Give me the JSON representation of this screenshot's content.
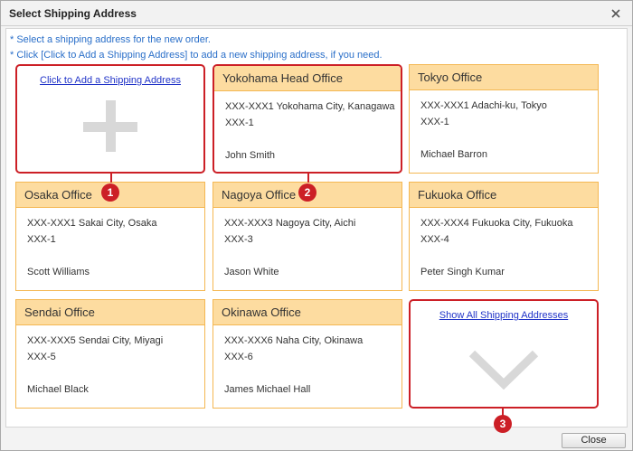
{
  "dialog": {
    "title": "Select Shipping Address",
    "close_icon": "close-icon"
  },
  "instructions": [
    "* Select a shipping address for the new order.",
    "* Click [Click to Add a Shipping Address] to add a new shipping address, if you need."
  ],
  "add_card": {
    "link": "Click to Add a Shipping Address",
    "icon": "plus-icon"
  },
  "offices": [
    {
      "name": "Yokohama Head Office",
      "line1": "XXX-XXX1 Yokohama City, Kanagawa",
      "line2": "XXX-1",
      "person": "John Smith"
    },
    {
      "name": "Tokyo Office",
      "line1": "XXX-XXX1 Adachi-ku, Tokyo",
      "line2": "XXX-1",
      "person": "Michael Barron"
    },
    {
      "name": "Osaka Office",
      "line1": "XXX-XXX1 Sakai City, Osaka",
      "line2": "XXX-1",
      "person": "Scott Williams"
    },
    {
      "name": "Nagoya Office",
      "line1": "XXX-XXX3 Nagoya City, Aichi",
      "line2": "XXX-3",
      "person": "Jason White"
    },
    {
      "name": "Fukuoka Office",
      "line1": "XXX-XXX4 Fukuoka City, Fukuoka",
      "line2": "XXX-4",
      "person": "Peter Singh Kumar"
    },
    {
      "name": "Sendai Office",
      "line1": "XXX-XXX5 Sendai City, Miyagi",
      "line2": "XXX-5",
      "person": "Michael Black"
    },
    {
      "name": "Okinawa Office",
      "line1": "XXX-XXX6 Naha City, Okinawa",
      "line2": "XXX-6",
      "person": "James Michael Hall"
    }
  ],
  "show_all_card": {
    "link": "Show All Shipping Addresses",
    "icon": "chevron-down-icon"
  },
  "callouts": [
    "1",
    "2",
    "3"
  ],
  "footer": {
    "close_label": "Close"
  },
  "colors": {
    "highlight": "#cc1f26",
    "card_header": "#fddca0",
    "card_border": "#f4b752",
    "link": "#2033c8",
    "instruction_text": "#2a6fc9"
  }
}
